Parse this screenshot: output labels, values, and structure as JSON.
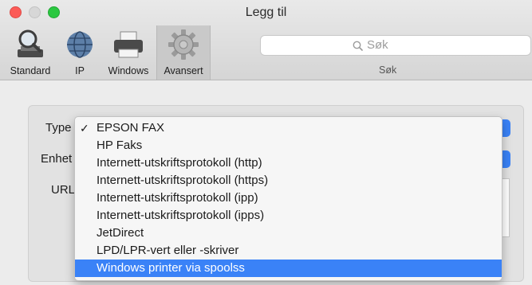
{
  "window": {
    "title": "Legg til"
  },
  "toolbar": {
    "items": [
      {
        "label": "Standard",
        "icon": "magnifier-printer-icon"
      },
      {
        "label": "IP",
        "icon": "globe-icon"
      },
      {
        "label": "Windows",
        "icon": "printer-icon"
      },
      {
        "label": "Avansert",
        "icon": "gear-icon",
        "selected": true
      }
    ]
  },
  "search": {
    "placeholder": "Søk",
    "label": "Søk"
  },
  "form": {
    "type_label": "Type",
    "device_label": "Enhet",
    "url_label": "URL"
  },
  "menu": {
    "items": [
      {
        "label": "EPSON FAX",
        "checked": true
      },
      {
        "label": "HP Faks"
      },
      {
        "label": "Internett-utskriftsprotokoll (http)"
      },
      {
        "label": "Internett-utskriftsprotokoll (https)"
      },
      {
        "label": "Internett-utskriftsprotokoll (ipp)"
      },
      {
        "label": "Internett-utskriftsprotokoll (ipps)"
      },
      {
        "label": "JetDirect"
      },
      {
        "label": "LPD/LPR-vert eller -skriver"
      },
      {
        "label": "Windows printer via spoolss",
        "highlighted": true
      }
    ],
    "check_glyph": "✓"
  },
  "colors": {
    "accent": "#3a82f7",
    "close": "#fc5b57",
    "zoom": "#2ac840"
  }
}
